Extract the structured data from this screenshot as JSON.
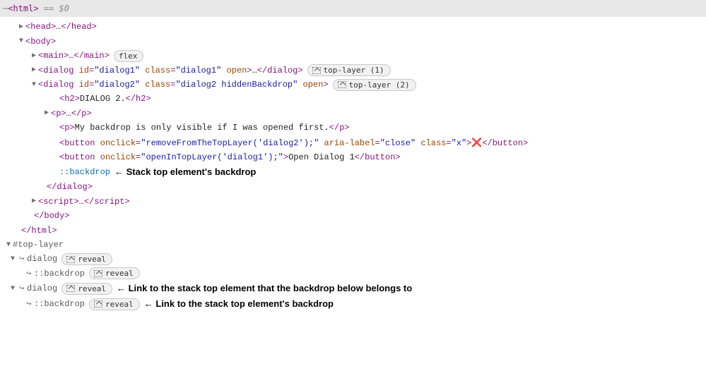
{
  "topbar": {
    "dots": "⋯",
    "left": "<html>",
    "eq": "==",
    "dollar": "$0"
  },
  "tree": {
    "head": {
      "open": "<head>",
      "ellipsis": "…",
      "close": "</head>"
    },
    "body": {
      "open": "<body>",
      "close": "</body>"
    },
    "main": {
      "open": "<main>",
      "ellipsis": "…",
      "close": "</main>",
      "badge": "flex"
    },
    "dialog1": {
      "open_lt": "<",
      "tag": "dialog",
      "attr_id_name": "id",
      "attr_id_val": "\"dialog1\"",
      "attr_class_name": "class",
      "attr_class_val": "\"dialog1\"",
      "attr_open": "open",
      "gt": ">",
      "ellipsis": "…",
      "close": "</dialog>",
      "badge": "top-layer (1)"
    },
    "dialog2": {
      "open_lt": "<",
      "tag": "dialog",
      "attr_id_name": "id",
      "attr_id_val": "\"dialog2\"",
      "attr_class_name": "class",
      "attr_class_val": "\"dialog2 hiddenBackdrop\"",
      "attr_open": "open",
      "gt": ">",
      "badge": "top-layer (2)",
      "h2_open": "<h2>",
      "h2_text": "DIALOG 2.",
      "h2_close": "</h2>",
      "p1_open": "<p>",
      "p1_ellipsis": "…",
      "p1_close": "</p>",
      "p2_open": "<p>",
      "p2_text": "My backdrop is only visible if I was opened first.",
      "p2_close": "</p>",
      "btn1_open_lt": "<",
      "btn1_tag": "button",
      "btn1_onclick_name": "onclick",
      "btn1_onclick_val": "\"removeFromTheTopLayer('dialog2');\"",
      "btn1_aria_name": "aria-label",
      "btn1_aria_val": "\"close\"",
      "btn1_class_name": "class",
      "btn1_class_val": "\"x\"",
      "btn1_gt": ">",
      "btn1_text": "❌",
      "btn1_close": "</button>",
      "btn2_open_lt": "<",
      "btn2_tag": "button",
      "btn2_onclick_name": "onclick",
      "btn2_onclick_val": "\"openInTopLayer('dialog1');\"",
      "btn2_gt": ">",
      "btn2_text": "Open Dialog 1",
      "btn2_close": "</button>",
      "backdrop": "::backdrop",
      "backdrop_annot": "← Stack top element's backdrop",
      "close": "</dialog>"
    },
    "script": {
      "open": "<script>",
      "ellipsis": "…",
      "close": "</script>"
    },
    "html_close": "</html>"
  },
  "toplayer": {
    "header": "#top-layer",
    "dialog_label": "dialog",
    "backdrop_label": "::backdrop",
    "reveal": "reveal",
    "annot1": "← Link to the stack top element that the backdrop below belongs to",
    "annot2": "← Link to the stack top element's backdrop"
  }
}
